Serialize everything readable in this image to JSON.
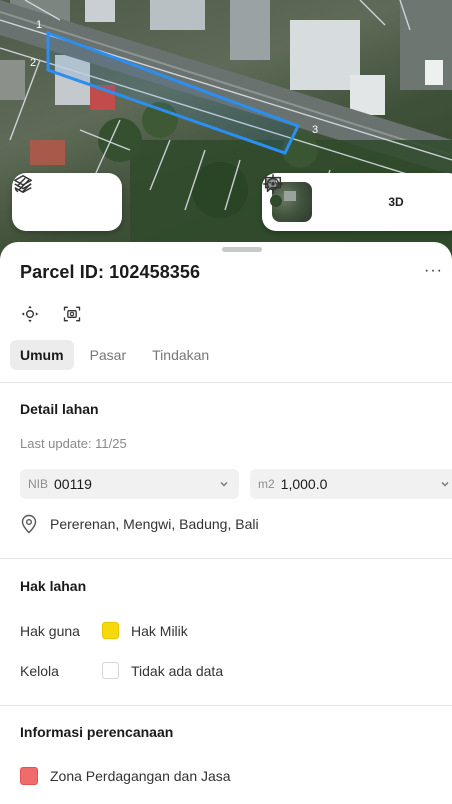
{
  "map": {
    "parcel_corner_labels": [
      "1",
      "2",
      "3"
    ],
    "parcel_color": "#2b8ff0",
    "btn_3d": "3D"
  },
  "sheet": {
    "title": "Parcel ID: 102458356",
    "more_label": "···",
    "close_label": "✕",
    "tabs": [
      {
        "label": "Umum",
        "active": true
      },
      {
        "label": "Pasar",
        "active": false
      },
      {
        "label": "Tindakan",
        "active": false
      }
    ]
  },
  "detail": {
    "title": "Detail lahan",
    "last_update": "Last update: 11/25",
    "nib_prefix": "NIB",
    "nib_value": "00119",
    "area_prefix": "m2",
    "area_value": "1,000.0",
    "address": "Pererenan, Mengwi, Badung, Bali"
  },
  "rights": {
    "title": "Hak lahan",
    "items": [
      {
        "label": "Hak guna",
        "value": "Hak Milik",
        "color": "#f5d90a"
      },
      {
        "label": "Kelola",
        "value": "Tidak ada data",
        "color": "#ffffff"
      }
    ]
  },
  "planning": {
    "title": "Informasi perencanaan",
    "zone": "Zona Perdagangan dan Jasa",
    "zone_color": "#f26b6b"
  },
  "icons": [
    "layers-icon",
    "draw-icon",
    "map-style-thumbnail",
    "locate-icon",
    "chat-icon",
    "focus-icon",
    "screenshot-icon",
    "chevron-down-icon",
    "location-pin-icon",
    "info-icon"
  ]
}
